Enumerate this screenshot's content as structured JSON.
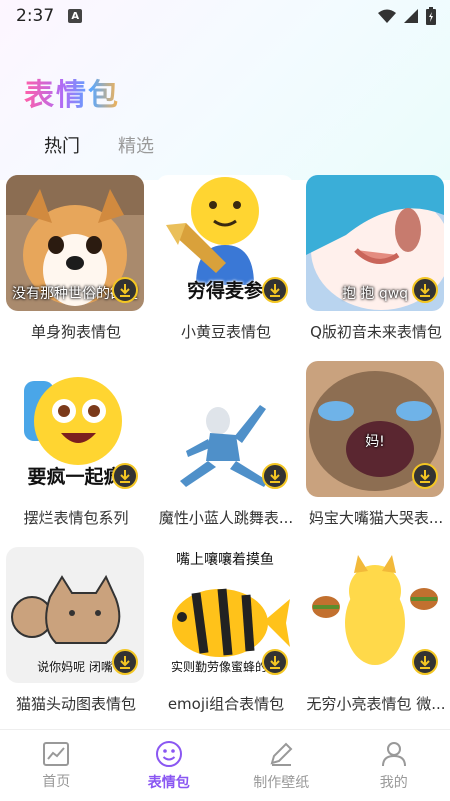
{
  "status_bar": {
    "time": "2:37",
    "notification_icon": "A"
  },
  "page": {
    "title": "表情包"
  },
  "tabs": [
    {
      "label": "热门",
      "active": true
    },
    {
      "label": "精选",
      "active": false
    }
  ],
  "packs": [
    {
      "label": "单身狗表情包",
      "overlay": "没有那种世俗的欲望",
      "icon": "corgi"
    },
    {
      "label": "小黄豆表情包",
      "overlay": "穷得麦参",
      "icon": "yellow-bean"
    },
    {
      "label": "Q版初音未来表情包",
      "overlay": "抱 抱 qwq",
      "icon": "miku"
    },
    {
      "label": "摆烂表情包系列",
      "overlay": "要疯一起疯",
      "icon": "crazy-emoji"
    },
    {
      "label": "魔性小蓝人跳舞表...",
      "overlay": "",
      "icon": "blue-man"
    },
    {
      "label": "妈宝大嘴猫大哭表...",
      "overlay": "妈!",
      "icon": "crying-cat"
    },
    {
      "label": "猫猫头动图表情包",
      "overlay": "说你妈呢 闭嘴",
      "icon": "cat-head"
    },
    {
      "label": "emoji组合表情包",
      "overlay": "实则勤劳像蜜蜂的洞",
      "top_text": "嘴上嚷嚷着摸鱼",
      "icon": "bee-fish"
    },
    {
      "label": "无穷小亮表情包 微...",
      "overlay": "",
      "icon": "burger-dog"
    }
  ],
  "bottom_nav": [
    {
      "label": "首页",
      "icon": "chart-icon",
      "active": false
    },
    {
      "label": "表情包",
      "icon": "smile-icon",
      "active": true
    },
    {
      "label": "制作壁纸",
      "icon": "pen-icon",
      "active": false
    },
    {
      "label": "我的",
      "icon": "user-icon",
      "active": false
    }
  ],
  "colors": {
    "accent": "#8a57f2",
    "download_ring": "#f3c623"
  }
}
